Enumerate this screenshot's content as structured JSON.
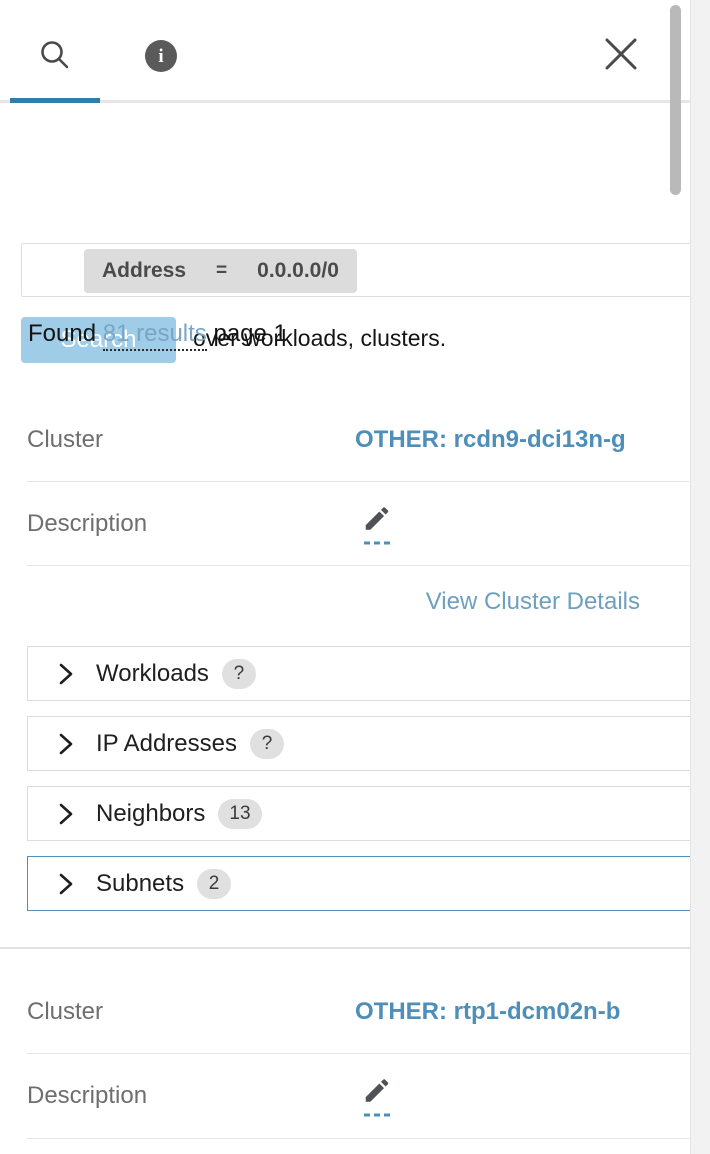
{
  "window": {
    "close_label": "×"
  },
  "tabs": [
    {
      "id": "search",
      "icon": "search-icon",
      "active": true
    },
    {
      "id": "info",
      "icon": "info-icon",
      "label": "i",
      "active": false
    }
  ],
  "search": {
    "chip": {
      "key": "Address",
      "operator": "=",
      "value": "0.0.0.0/0"
    },
    "button_label": "Search",
    "scope_text": "over workloads, clusters."
  },
  "results_summary": {
    "prefix": "Found",
    "count_label": "81 results",
    "suffix": "page 1"
  },
  "results": [
    {
      "cluster_label": "Cluster",
      "cluster_value": "OTHER: rcdn9-dci13n-g",
      "description_label": "Description",
      "description_edit_icon": "pencil-icon",
      "details_link": "View Cluster Details",
      "accordions": [
        {
          "label": "Workloads",
          "count": "?",
          "focused": false
        },
        {
          "label": "IP Addresses",
          "count": "?",
          "focused": false
        },
        {
          "label": "Neighbors",
          "count": "13",
          "focused": false
        },
        {
          "label": "Subnets",
          "count": "2",
          "focused": true
        }
      ]
    },
    {
      "cluster_label": "Cluster",
      "cluster_value": "OTHER: rtp1-dcm02n-b",
      "description_label": "Description",
      "description_edit_icon": "pencil-icon",
      "details_link": null,
      "accordions": []
    }
  ],
  "colors": {
    "accent_blue": "#2f7fab",
    "link_blue": "#4d8fb8",
    "muted_link_blue": "#6d9fbe",
    "search_button": "#9fcce6",
    "chip_bg": "#dcdcdc",
    "badge_bg": "#e0e0e0",
    "label_gray": "#6e6e6e"
  }
}
